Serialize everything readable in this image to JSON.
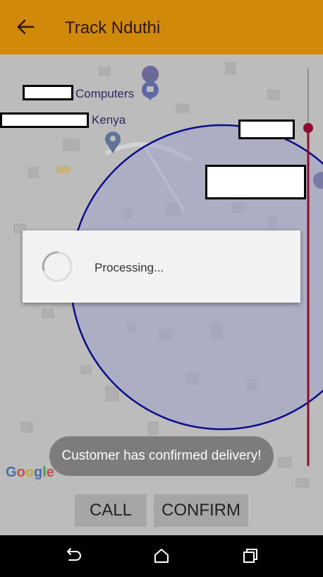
{
  "appbar": {
    "title": "Track Nduthi"
  },
  "map": {
    "labels": {
      "computers": "Computers",
      "kenya": "Kenya"
    },
    "google_logo": "Google",
    "colors": {
      "circle_stroke": "#0b0b8c",
      "route": "#8a0f2c"
    }
  },
  "dialog": {
    "text": "Processing..."
  },
  "toast": {
    "text": "Customer has confirmed delivery!"
  },
  "actions": {
    "call_label": "CALL",
    "confirm_label": "CONFIRM"
  },
  "navbar": {
    "icons": [
      "back-icon",
      "home-icon",
      "recents-icon"
    ]
  }
}
